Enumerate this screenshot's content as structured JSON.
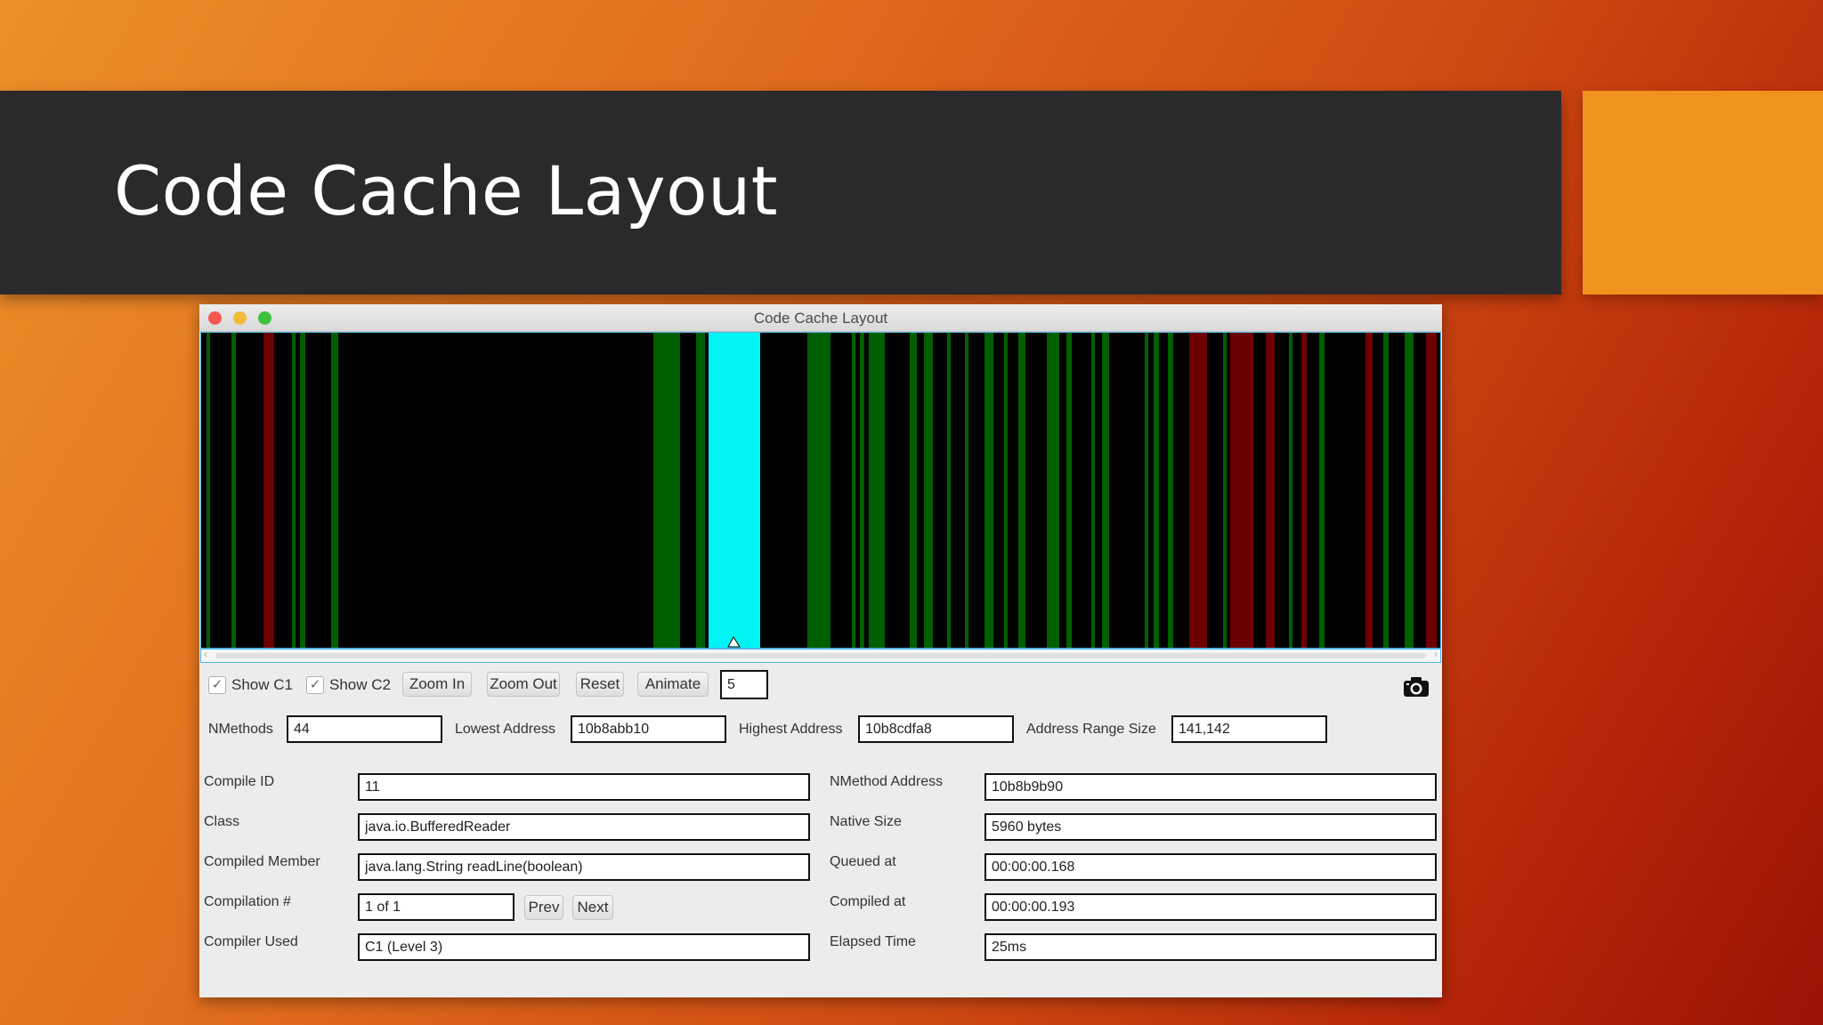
{
  "slide": {
    "title": "Code Cache Layout"
  },
  "window": {
    "title": "Code Cache Layout"
  },
  "cache_view": {
    "colors": {
      "c1": "#005f00",
      "c2": "#6d0000",
      "selected": "#00f4f4",
      "background": "#000000"
    }
  },
  "toolbar": {
    "show_c1": {
      "label": "Show C1",
      "checked": true
    },
    "show_c2": {
      "label": "Show C2",
      "checked": true
    },
    "zoom_in": "Zoom In",
    "zoom_out": "Zoom Out",
    "reset": "Reset",
    "animate": "Animate",
    "animate_value": "5",
    "camera_icon": "camera-icon"
  },
  "stats": {
    "nmethods_label": "NMethods",
    "nmethods": "44",
    "lowest_label": "Lowest Address",
    "lowest": "10b8abb10",
    "highest_label": "Highest Address",
    "highest": "10b8cdfa8",
    "range_label": "Address Range Size",
    "range": "141,142"
  },
  "details": {
    "compile_id_label": "Compile ID",
    "compile_id": "11",
    "class_label": "Class",
    "class": "java.io.BufferedReader",
    "member_label": "Compiled Member",
    "member": "java.lang.String readLine(boolean)",
    "compilation_label": "Compilation #",
    "compilation": "1 of 1",
    "prev": "Prev",
    "next": "Next",
    "compiler_label": "Compiler Used",
    "compiler": "C1 (Level 3)",
    "nmethod_addr_label": "NMethod Address",
    "nmethod_addr": "10b8b9b90",
    "native_size_label": "Native Size",
    "native_size": "5960 bytes",
    "queued_label": "Queued at",
    "queued": "00:00:00.168",
    "compiled_label": "Compiled at",
    "compiled": "00:00:00.193",
    "elapsed_label": "Elapsed Time",
    "elapsed": "25ms"
  }
}
